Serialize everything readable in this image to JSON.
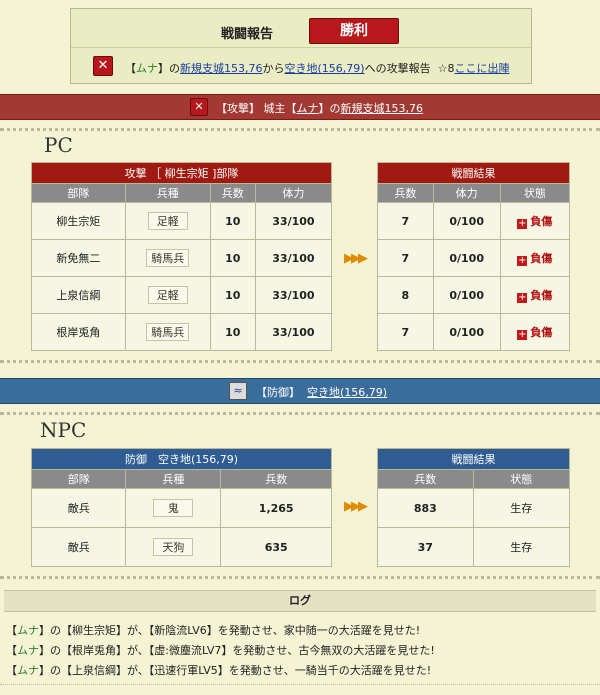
{
  "header": {
    "title": "戦闘報告",
    "result": "勝利",
    "report": {
      "open": "【",
      "lord": "ムナ",
      "close": "】の",
      "from": "新規支城153,76",
      "from_suffix": "から",
      "to": "空き地(156,79)",
      "to_suffix": "への攻撃報告",
      "star": "☆8",
      "link": "ここに出陣"
    }
  },
  "attack_bar": {
    "label": "【攻撃】 城主",
    "lord": "ムナ",
    "lord_open": "【",
    "lord_close": "】の",
    "location": "新規支城153,76"
  },
  "defense_bar": {
    "label": "【防御】",
    "location": "空き地(156,79)"
  },
  "pc": {
    "heading": "PC",
    "table_caption": "攻撃 ［ 柳生宗矩 ]部隊",
    "columns": [
      "部隊",
      "兵種",
      "兵数",
      "体力"
    ],
    "rows": [
      {
        "unit": "柳生宗矩",
        "type": "足軽",
        "count": "10",
        "hp": "33/100"
      },
      {
        "unit": "新免無二",
        "type": "騎馬兵",
        "count": "10",
        "hp": "33/100"
      },
      {
        "unit": "上泉信綱",
        "type": "足軽",
        "count": "10",
        "hp": "33/100"
      },
      {
        "unit": "根岸兎角",
        "type": "騎馬兵",
        "count": "10",
        "hp": "33/100"
      }
    ],
    "result_caption": "戦闘結果",
    "result_columns": [
      "兵数",
      "体力",
      "状態"
    ],
    "results": [
      {
        "count": "7",
        "hp": "0/100",
        "status": "負傷"
      },
      {
        "count": "7",
        "hp": "0/100",
        "status": "負傷"
      },
      {
        "count": "8",
        "hp": "0/100",
        "status": "負傷"
      },
      {
        "count": "7",
        "hp": "0/100",
        "status": "負傷"
      }
    ]
  },
  "npc": {
    "heading": "NPC",
    "table_caption": "防御　空き地(156,79)",
    "columns": [
      "部隊",
      "兵種",
      "兵数"
    ],
    "rows": [
      {
        "unit": "敵兵",
        "type": "鬼",
        "count": "1,265"
      },
      {
        "unit": "敵兵",
        "type": "天狗",
        "count": "635"
      }
    ],
    "result_caption": "戦闘結果",
    "result_columns": [
      "兵数",
      "状態"
    ],
    "results": [
      {
        "count": "883",
        "status": "生存"
      },
      {
        "count": "37",
        "status": "生存"
      }
    ]
  },
  "log": {
    "title": "ログ",
    "lines": [
      {
        "lord": "ムナ",
        "a": "】の【",
        "general": "柳生宗矩",
        "b": "】が、【",
        "skill": "新陰流LV6",
        "c": "】を発動させ、家中随一の大活躍を見せた!"
      },
      {
        "lord": "ムナ",
        "a": "】の【",
        "general": "根岸兎角",
        "b": "】が、【",
        "skill": "虚:微塵流LV7",
        "c": "】を発動させ、古今無双の大活躍を見せた!"
      },
      {
        "lord": "ムナ",
        "a": "】の【",
        "general": "上泉信綱",
        "b": "】が、【",
        "skill": "迅速行軍LV5",
        "c": "】を発動させ、一騎当千の大活躍を見せた!"
      }
    ]
  },
  "colors": {
    "background": "#f4f4d4",
    "attack_red": "#a23a33",
    "defense_blue": "#3a6c9c",
    "victory": "#b8171c",
    "link": "#1a3f9c",
    "log_green": "#2e7d2e"
  },
  "icons": [
    "crossed-swords-icon",
    "shield-icon",
    "red-cross-icon",
    "triple-arrow-icon"
  ]
}
